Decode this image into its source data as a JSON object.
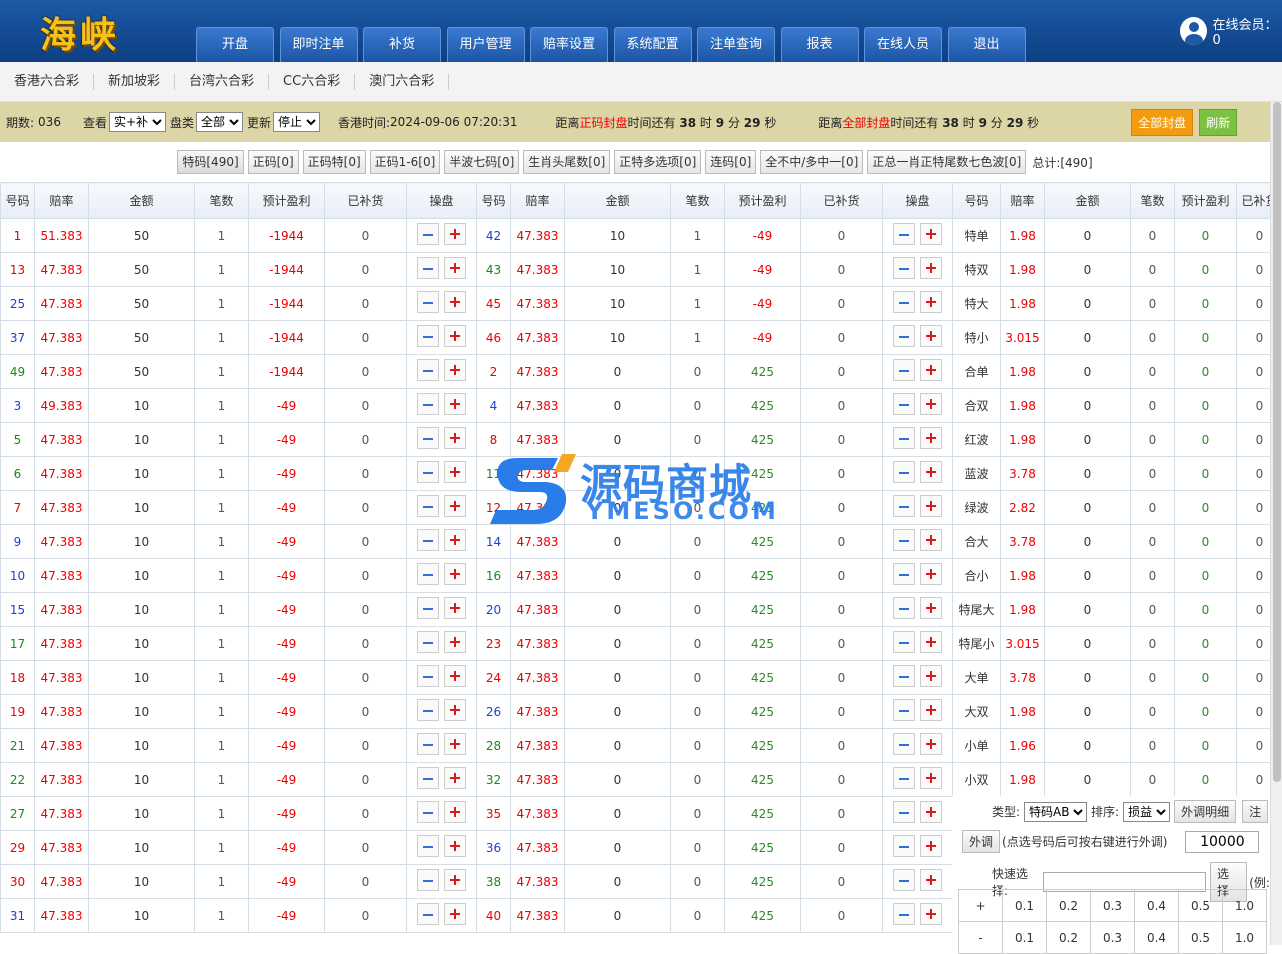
{
  "app": {
    "logo": "海峡",
    "online_label": "在线会员：0"
  },
  "nav": [
    "开盘",
    "即时注单",
    "补货",
    "用户管理",
    "赔率设置",
    "系统配置",
    "注单查询",
    "报表",
    "在线人员",
    "退出"
  ],
  "lotteries": [
    "香港六合彩",
    "新加坡彩",
    "台湾六合彩",
    "CC六合彩",
    "澳门六合彩"
  ],
  "info": {
    "period_label": "期数:",
    "period": "036",
    "view_label": "查看",
    "view_value": "实+补",
    "type_label": "盘类",
    "type_value": "全部",
    "update_label": "更新",
    "update_value": "停止",
    "hk_time_label": "香港时间:",
    "hk_time": "2024-09-06 07:20:31",
    "c1_pre": "距离",
    "c1_red": "正码封盘",
    "c1_mid": "时间还有",
    "c1_h": "38",
    "c1_hu": "时",
    "c1_m": "9",
    "c1_mu": "分",
    "c1_s": "29",
    "c1_su": "秒",
    "c2_pre": "距离",
    "c2_red": "全部封盘",
    "c2_mid": "时间还有",
    "c2_h": "38",
    "c2_hu": "时",
    "c2_m": "9",
    "c2_mu": "分",
    "c2_s": "29",
    "c2_su": "秒",
    "btn_close_all": "全部封盘",
    "btn_refresh": "刷新"
  },
  "tabs": [
    "特码[490]",
    "正码[0]",
    "正码特[0]",
    "正码1-6[0]",
    "半波七码[0]",
    "生肖头尾数[0]",
    "正特多选项[0]",
    "连码[0]",
    "全不中/多中一[0]",
    "正总一肖正特尾数七色波[0]"
  ],
  "tab_total": "总计:[490]",
  "headers": {
    "num": "号码",
    "odds": "赔率",
    "amount": "金额",
    "count": "笔数",
    "profit": "预计盈利",
    "filled": "已补货",
    "ops": "操盘"
  },
  "side_headers": [
    "号码",
    "赔率",
    "金额",
    "笔数",
    "预计盈利",
    "已补货"
  ],
  "left_rows": [
    {
      "n": "1",
      "c": "r",
      "o": "51.383",
      "a": "50",
      "k": "1",
      "p": "-1944",
      "f": "0"
    },
    {
      "n": "13",
      "c": "r",
      "o": "47.383",
      "a": "50",
      "k": "1",
      "p": "-1944",
      "f": "0"
    },
    {
      "n": "25",
      "c": "b",
      "o": "47.383",
      "a": "50",
      "k": "1",
      "p": "-1944",
      "f": "0"
    },
    {
      "n": "37",
      "c": "b",
      "o": "47.383",
      "a": "50",
      "k": "1",
      "p": "-1944",
      "f": "0"
    },
    {
      "n": "49",
      "c": "g",
      "o": "47.383",
      "a": "50",
      "k": "1",
      "p": "-1944",
      "f": "0"
    },
    {
      "n": "3",
      "c": "b",
      "o": "49.383",
      "a": "10",
      "k": "1",
      "p": "-49",
      "f": "0"
    },
    {
      "n": "5",
      "c": "g",
      "o": "47.383",
      "a": "10",
      "k": "1",
      "p": "-49",
      "f": "0"
    },
    {
      "n": "6",
      "c": "g",
      "o": "47.383",
      "a": "10",
      "k": "1",
      "p": "-49",
      "f": "0"
    },
    {
      "n": "7",
      "c": "r",
      "o": "47.383",
      "a": "10",
      "k": "1",
      "p": "-49",
      "f": "0"
    },
    {
      "n": "9",
      "c": "b",
      "o": "47.383",
      "a": "10",
      "k": "1",
      "p": "-49",
      "f": "0"
    },
    {
      "n": "10",
      "c": "b",
      "o": "47.383",
      "a": "10",
      "k": "1",
      "p": "-49",
      "f": "0"
    },
    {
      "n": "15",
      "c": "b",
      "o": "47.383",
      "a": "10",
      "k": "1",
      "p": "-49",
      "f": "0"
    },
    {
      "n": "17",
      "c": "g",
      "o": "47.383",
      "a": "10",
      "k": "1",
      "p": "-49",
      "f": "0"
    },
    {
      "n": "18",
      "c": "r",
      "o": "47.383",
      "a": "10",
      "k": "1",
      "p": "-49",
      "f": "0"
    },
    {
      "n": "19",
      "c": "r",
      "o": "47.383",
      "a": "10",
      "k": "1",
      "p": "-49",
      "f": "0"
    },
    {
      "n": "21",
      "c": "g",
      "o": "47.383",
      "a": "10",
      "k": "1",
      "p": "-49",
      "f": "0"
    },
    {
      "n": "22",
      "c": "g",
      "o": "47.383",
      "a": "10",
      "k": "1",
      "p": "-49",
      "f": "0"
    },
    {
      "n": "27",
      "c": "g",
      "o": "47.383",
      "a": "10",
      "k": "1",
      "p": "-49",
      "f": "0"
    },
    {
      "n": "29",
      "c": "r",
      "o": "47.383",
      "a": "10",
      "k": "1",
      "p": "-49",
      "f": "0"
    },
    {
      "n": "30",
      "c": "r",
      "o": "47.383",
      "a": "10",
      "k": "1",
      "p": "-49",
      "f": "0"
    },
    {
      "n": "31",
      "c": "b",
      "o": "47.383",
      "a": "10",
      "k": "1",
      "p": "-49",
      "f": "0"
    }
  ],
  "right_rows": [
    {
      "n": "42",
      "c": "b",
      "o": "47.383",
      "a": "10",
      "k": "1",
      "p": "-49",
      "f": "0"
    },
    {
      "n": "43",
      "c": "g",
      "o": "47.383",
      "a": "10",
      "k": "1",
      "p": "-49",
      "f": "0"
    },
    {
      "n": "45",
      "c": "r",
      "o": "47.383",
      "a": "10",
      "k": "1",
      "p": "-49",
      "f": "0"
    },
    {
      "n": "46",
      "c": "r",
      "o": "47.383",
      "a": "10",
      "k": "1",
      "p": "-49",
      "f": "0"
    },
    {
      "n": "2",
      "c": "r",
      "o": "47.383",
      "a": "0",
      "k": "0",
      "p": "425",
      "f": "0"
    },
    {
      "n": "4",
      "c": "b",
      "o": "47.383",
      "a": "0",
      "k": "0",
      "p": "425",
      "f": "0"
    },
    {
      "n": "8",
      "c": "r",
      "o": "47.383",
      "a": "0",
      "k": "0",
      "p": "425",
      "f": "0"
    },
    {
      "n": "11",
      "c": "g",
      "o": "47.383",
      "a": "0",
      "k": "0",
      "p": "425",
      "f": "0"
    },
    {
      "n": "12",
      "c": "r",
      "o": "47.383",
      "a": "0",
      "k": "0",
      "p": "425",
      "f": "0"
    },
    {
      "n": "14",
      "c": "b",
      "o": "47.383",
      "a": "0",
      "k": "0",
      "p": "425",
      "f": "0"
    },
    {
      "n": "16",
      "c": "g",
      "o": "47.383",
      "a": "0",
      "k": "0",
      "p": "425",
      "f": "0"
    },
    {
      "n": "20",
      "c": "b",
      "o": "47.383",
      "a": "0",
      "k": "0",
      "p": "425",
      "f": "0"
    },
    {
      "n": "23",
      "c": "r",
      "o": "47.383",
      "a": "0",
      "k": "0",
      "p": "425",
      "f": "0"
    },
    {
      "n": "24",
      "c": "r",
      "o": "47.383",
      "a": "0",
      "k": "0",
      "p": "425",
      "f": "0"
    },
    {
      "n": "26",
      "c": "b",
      "o": "47.383",
      "a": "0",
      "k": "0",
      "p": "425",
      "f": "0"
    },
    {
      "n": "28",
      "c": "g",
      "o": "47.383",
      "a": "0",
      "k": "0",
      "p": "425",
      "f": "0"
    },
    {
      "n": "32",
      "c": "g",
      "o": "47.383",
      "a": "0",
      "k": "0",
      "p": "425",
      "f": "0"
    },
    {
      "n": "35",
      "c": "r",
      "o": "47.383",
      "a": "0",
      "k": "0",
      "p": "425",
      "f": "0"
    },
    {
      "n": "36",
      "c": "b",
      "o": "47.383",
      "a": "0",
      "k": "0",
      "p": "425",
      "f": "0"
    },
    {
      "n": "38",
      "c": "g",
      "o": "47.383",
      "a": "0",
      "k": "0",
      "p": "425",
      "f": "0"
    },
    {
      "n": "40",
      "c": "r",
      "o": "47.383",
      "a": "0",
      "k": "0",
      "p": "425",
      "f": "0"
    }
  ],
  "side_rows": [
    {
      "n": "特单",
      "o": "1.98",
      "a": "0",
      "k": "0",
      "p": "0",
      "f": "0"
    },
    {
      "n": "特双",
      "o": "1.98",
      "a": "0",
      "k": "0",
      "p": "0",
      "f": "0"
    },
    {
      "n": "特大",
      "o": "1.98",
      "a": "0",
      "k": "0",
      "p": "0",
      "f": "0"
    },
    {
      "n": "特小",
      "o": "3.015",
      "a": "0",
      "k": "0",
      "p": "0",
      "f": "0"
    },
    {
      "n": "合单",
      "o": "1.98",
      "a": "0",
      "k": "0",
      "p": "0",
      "f": "0"
    },
    {
      "n": "合双",
      "o": "1.98",
      "a": "0",
      "k": "0",
      "p": "0",
      "f": "0"
    },
    {
      "n": "红波",
      "o": "1.98",
      "a": "0",
      "k": "0",
      "p": "0",
      "f": "0"
    },
    {
      "n": "蓝波",
      "o": "3.78",
      "a": "0",
      "k": "0",
      "p": "0",
      "f": "0"
    },
    {
      "n": "绿波",
      "o": "2.82",
      "a": "0",
      "k": "0",
      "p": "0",
      "f": "0"
    },
    {
      "n": "合大",
      "o": "3.78",
      "a": "0",
      "k": "0",
      "p": "0",
      "f": "0"
    },
    {
      "n": "合小",
      "o": "1.98",
      "a": "0",
      "k": "0",
      "p": "0",
      "f": "0"
    },
    {
      "n": "特尾大",
      "o": "1.98",
      "a": "0",
      "k": "0",
      "p": "0",
      "f": "0"
    },
    {
      "n": "特尾小",
      "o": "3.015",
      "a": "0",
      "k": "0",
      "p": "0",
      "f": "0"
    },
    {
      "n": "大单",
      "o": "3.78",
      "a": "0",
      "k": "0",
      "p": "0",
      "f": "0"
    },
    {
      "n": "大双",
      "o": "1.98",
      "a": "0",
      "k": "0",
      "p": "0",
      "f": "0"
    },
    {
      "n": "小单",
      "o": "1.96",
      "a": "0",
      "k": "0",
      "p": "0",
      "f": "0"
    },
    {
      "n": "小双",
      "o": "1.98",
      "a": "0",
      "k": "0",
      "p": "0",
      "f": "0"
    }
  ],
  "panel": {
    "type_label": "类型:",
    "type_value": "特码AB",
    "sort_label": "排序:",
    "sort_value": "损益",
    "detail_btn": "外调明细",
    "note_btn": "注",
    "out_btn": "外调",
    "out_hint": "(点选号码后可按右键进行外调)",
    "out_value": "10000",
    "quick_label": "快速选择:",
    "quick_placeholder": "",
    "choose_btn": "选择",
    "example": "(例:",
    "plus": "+",
    "minus": "-",
    "steps": [
      "0.1",
      "0.2",
      "0.3",
      "0.4",
      "0.5",
      "1.0"
    ]
  },
  "watermark": {
    "cn": "源码商城",
    "en": "YMESO.COM"
  },
  "colors": {
    "header_blue": "#1c5aa6",
    "info_bar": "#dcd5a6",
    "red": "#e00",
    "blue": "#1d3fd6",
    "green": "#1a8a1a",
    "orange": "#f39c12",
    "lime": "#7cc142"
  }
}
